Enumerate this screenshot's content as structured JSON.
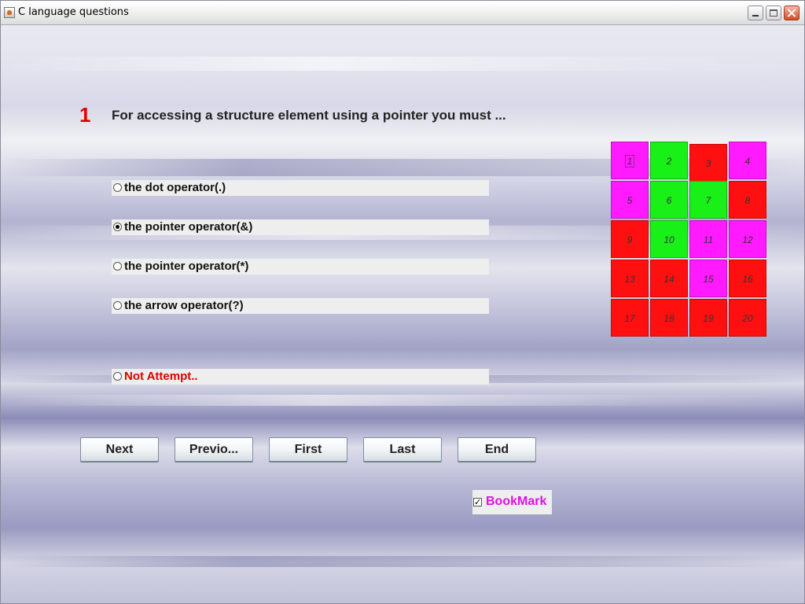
{
  "window": {
    "title": "C language questions"
  },
  "question": {
    "number": "1",
    "text": "For accessing a structure element using a pointer you must ..."
  },
  "options": [
    {
      "label": "the dot operator(.)",
      "selected": false
    },
    {
      "label": "the pointer operator(&)",
      "selected": true
    },
    {
      "label": "the pointer operator(*)",
      "selected": false
    },
    {
      "label": "the arrow operator(?)",
      "selected": false
    }
  ],
  "not_attempt": {
    "label": "Not Attempt..",
    "selected": false
  },
  "nav": {
    "next": "Next",
    "previous": "Previo...",
    "first": "First",
    "last": "Last",
    "end": "End"
  },
  "bookmark": {
    "label": "BookMark",
    "checked": true
  },
  "colors": {
    "magenta": "#ff1aff",
    "green": "#18f018",
    "red": "#ff1010",
    "question_number": "#e00000",
    "bookmark_label": "#e010e0"
  },
  "question_grid": [
    {
      "label": "1",
      "status": "magenta",
      "current": true
    },
    {
      "label": "2",
      "status": "green"
    },
    {
      "label": "3",
      "status": "red"
    },
    {
      "label": "4",
      "status": "magenta"
    },
    {
      "label": "5",
      "status": "magenta"
    },
    {
      "label": "6",
      "status": "green"
    },
    {
      "label": "7",
      "status": "green"
    },
    {
      "label": "8",
      "status": "red"
    },
    {
      "label": "9",
      "status": "red"
    },
    {
      "label": "10",
      "status": "green"
    },
    {
      "label": "11",
      "status": "magenta"
    },
    {
      "label": "12",
      "status": "magenta"
    },
    {
      "label": "13",
      "status": "red"
    },
    {
      "label": "14",
      "status": "red"
    },
    {
      "label": "15",
      "status": "magenta"
    },
    {
      "label": "16",
      "status": "red"
    },
    {
      "label": "17",
      "status": "red"
    },
    {
      "label": "18",
      "status": "red"
    },
    {
      "label": "19",
      "status": "red"
    },
    {
      "label": "20",
      "status": "red"
    }
  ]
}
